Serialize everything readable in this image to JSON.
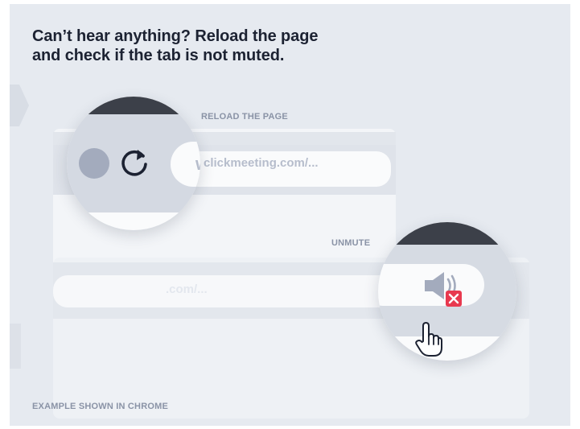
{
  "headline": {
    "line1": "Can’t hear anything? Reload the page",
    "line2": "and check if the tab is not muted."
  },
  "reload": {
    "caption": "RELOAD THE PAGE",
    "url_lens_fragment": "w",
    "url": "clickmeeting.com/...",
    "icon": "reload-icon"
  },
  "unmute": {
    "caption": "UNMUTE",
    "url_fragment": ".com/...",
    "url_prefix_faded": "",
    "icon": "muted-speaker-icon",
    "cursor_icon": "hand-pointer-icon"
  },
  "footer": {
    "caption": "EXAMPLE SHOWN IN CHROME"
  },
  "colors": {
    "background": "#e6eaf0",
    "headline": "#1c2232",
    "caption": "#8a93a6",
    "mute_badge": "#e8394f",
    "lens_dark": "#3c4049"
  }
}
